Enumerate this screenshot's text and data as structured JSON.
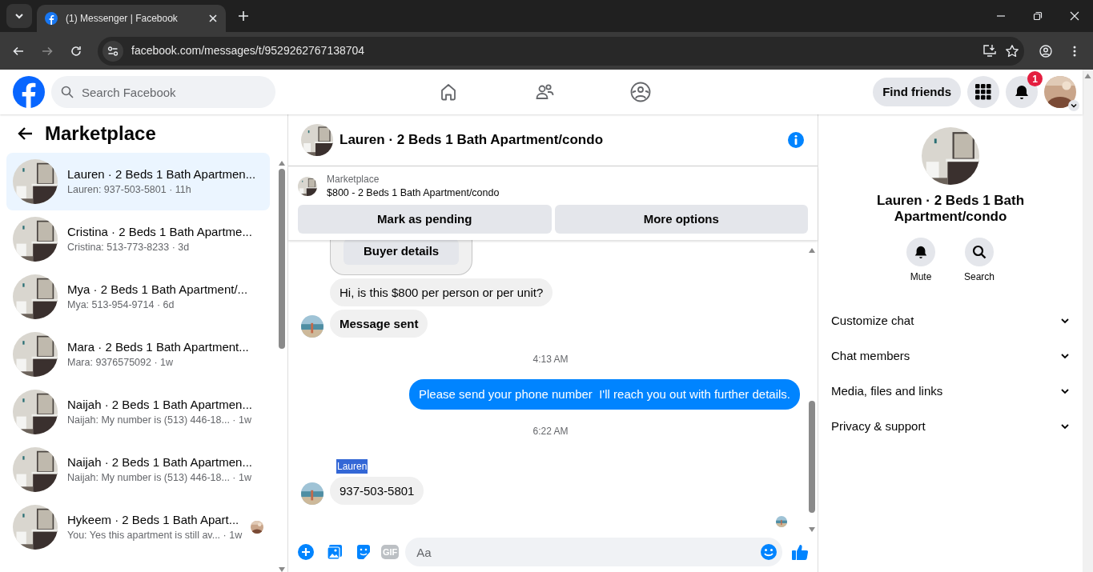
{
  "browser": {
    "tab_title": "(1) Messenger | Facebook",
    "url": "facebook.com/messages/t/9529262767138704"
  },
  "header": {
    "search_placeholder": "Search Facebook",
    "find_friends": "Find friends",
    "notification_count": "1"
  },
  "sidebar": {
    "title": "Marketplace",
    "conversations": [
      {
        "title": "Lauren · 2 Beds 1 Bath Apartmen...",
        "preview": "Lauren: 937-503-5801 · 11h",
        "selected": true,
        "seen": false
      },
      {
        "title": "Cristina · 2 Beds 1 Bath Apartme...",
        "preview": "Cristina: 513-773-8233 · 3d",
        "selected": false,
        "seen": false
      },
      {
        "title": "Mya · 2 Beds 1 Bath Apartment/...",
        "preview": "Mya: 513-954-9714 · 6d",
        "selected": false,
        "seen": false
      },
      {
        "title": "Mara · 2 Beds 1 Bath Apartment...",
        "preview": "Mara: 9376575092 · 1w",
        "selected": false,
        "seen": false
      },
      {
        "title": "Naijah · 2 Beds 1 Bath Apartmen...",
        "preview": "Naijah: My number is (513) 446-18... · 1w",
        "selected": false,
        "seen": false
      },
      {
        "title": "Naijah · 2 Beds 1 Bath Apartmen...",
        "preview": "Naijah: My number is (513) 446-18... · 1w",
        "selected": false,
        "seen": false
      },
      {
        "title": "Hykeem · 2 Beds 1 Bath Apart...",
        "preview": "You: Yes this apartment is still av... · 1w",
        "selected": false,
        "seen": true
      }
    ]
  },
  "chat": {
    "title": "Lauren · 2 Beds 1 Bath Apartment/condo",
    "listing": {
      "label": "Marketplace",
      "text": "$800 - 2 Beds 1 Bath Apartment/condo"
    },
    "actions": [
      "Mark as pending",
      "More options"
    ],
    "messages": [
      {
        "kind": "card",
        "button": "Buyer details"
      },
      {
        "kind": "incoming",
        "text": "Hi, is this $800 per person or per unit?",
        "bold": false,
        "avatar": false
      },
      {
        "kind": "incoming",
        "text": "Message sent",
        "bold": true,
        "avatar": true
      },
      {
        "kind": "time",
        "text": "4:13 AM"
      },
      {
        "kind": "outgoing",
        "text": "Please send your phone number  I'll reach you out with further details."
      },
      {
        "kind": "time",
        "text": "6:22 AM"
      },
      {
        "kind": "sender",
        "text": "Lauren",
        "highlighted": true
      },
      {
        "kind": "incoming",
        "text": "937-503-5801",
        "bold": false,
        "avatar": true
      },
      {
        "kind": "seen"
      }
    ],
    "composer": {
      "placeholder": "Aa",
      "gif_label": "GIF"
    }
  },
  "details": {
    "title": "Lauren · 2 Beds 1 Bath Apartment/condo",
    "actions": [
      {
        "kind": "mute",
        "label": "Mute"
      },
      {
        "kind": "search",
        "label": "Search"
      }
    ],
    "sections": [
      {
        "label": "Customize chat",
        "expanded": false
      },
      {
        "label": "Chat members",
        "expanded": false
      },
      {
        "label": "Media, files and links",
        "expanded": false
      },
      {
        "label": "Privacy & support",
        "expanded": false
      }
    ]
  }
}
